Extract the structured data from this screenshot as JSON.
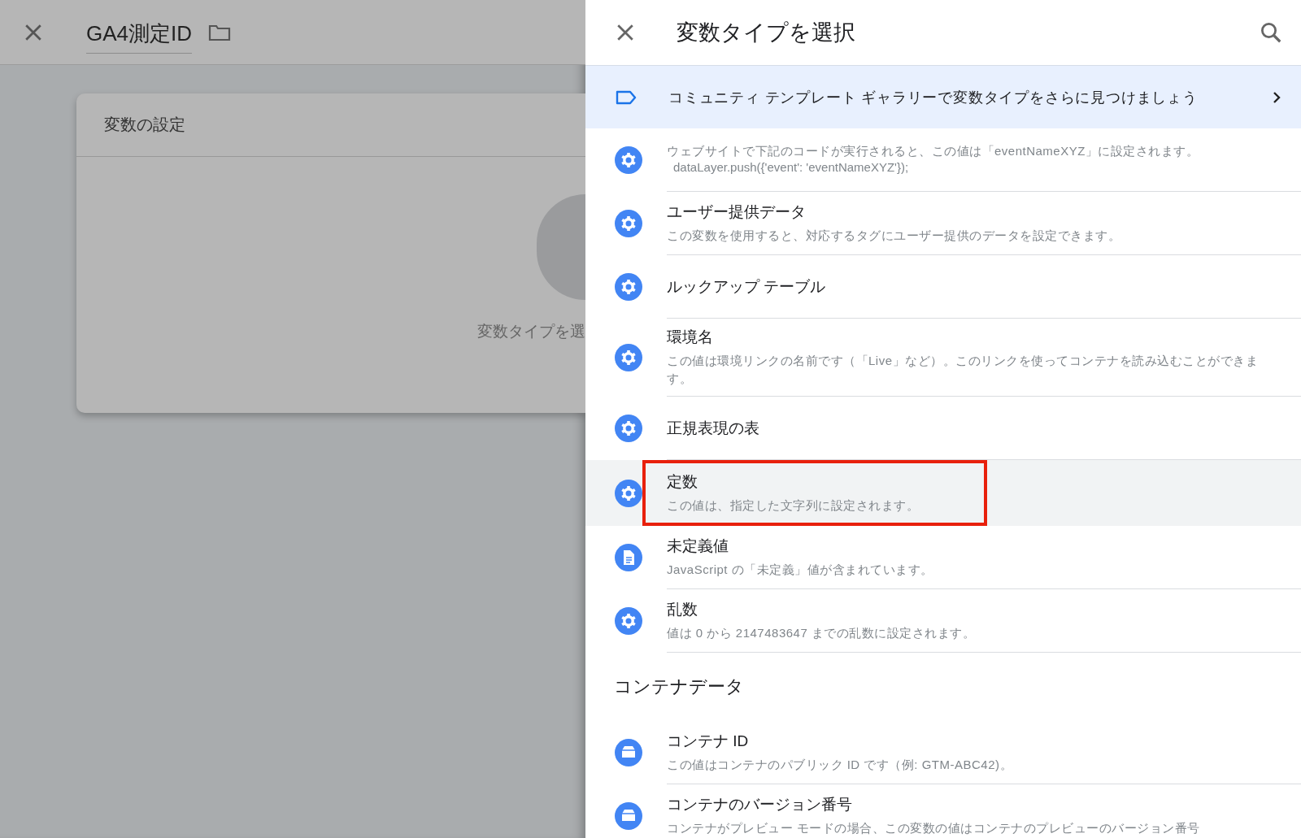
{
  "backdrop": {
    "title": "GA4測定ID",
    "card_title": "変数の設定",
    "card_hint": "変数タイプを選"
  },
  "panel": {
    "title": "変数タイプを選択",
    "banner": {
      "text": "コミュニティ テンプレート ギャラリーで変数タイプをさらに見つけましょう"
    },
    "items": [
      {
        "kind": "gear",
        "description": "ウェブサイトで下記のコードが実行されると、この値は「eventNameXYZ」に設定されます。",
        "code": "dataLayer.push({'event': 'eventNameXYZ'});",
        "selected": false,
        "highlighted": false
      },
      {
        "kind": "gear",
        "title": "ユーザー提供データ",
        "description": "この変数を使用すると、対応するタグにユーザー提供のデータを設定できます。",
        "selected": false,
        "highlighted": false
      },
      {
        "kind": "gear",
        "title": "ルックアップ テーブル",
        "selected": false,
        "highlighted": false
      },
      {
        "kind": "gear",
        "title": "環境名",
        "description": "この値は環境リンクの名前です（「Live」など）。このリンクを使ってコンテナを読み込むことができます。",
        "selected": false,
        "highlighted": false
      },
      {
        "kind": "gear",
        "title": "正規表現の表",
        "selected": false,
        "highlighted": false
      },
      {
        "kind": "gear",
        "title": "定数",
        "description": "この値は、指定した文字列に設定されます。",
        "selected": true,
        "highlighted": true
      },
      {
        "kind": "document",
        "title": "未定義値",
        "description": "JavaScript の「未定義」値が含まれています。",
        "selected": false,
        "highlighted": false
      },
      {
        "kind": "gear",
        "title": "乱数",
        "description": "値は 0 から 2147483647 までの乱数に設定されます。",
        "selected": false,
        "highlighted": false
      },
      {
        "kind": "section",
        "title": "コンテナデータ"
      },
      {
        "kind": "container",
        "title": "コンテナ ID",
        "description": "この値はコンテナのパブリック ID です（例: GTM-ABC42)。",
        "selected": false,
        "highlighted": false
      },
      {
        "kind": "container",
        "title": "コンテナのバージョン番号",
        "description": "コンテナがプレビュー モードの場合、この変数の値はコンテナのプレビューのバージョン番号",
        "selected": false,
        "highlighted": false
      }
    ]
  }
}
